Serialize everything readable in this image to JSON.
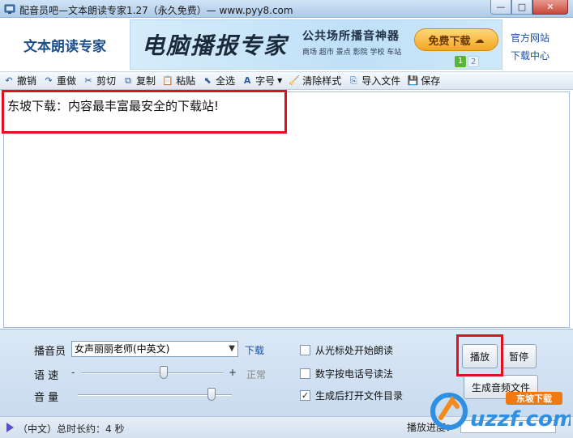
{
  "window": {
    "title": "配音员吧—文本朗读专家1.27（永久免费）— www.pyy8.com",
    "controls": [
      "—",
      "□",
      "✕"
    ]
  },
  "banner": {
    "brand": "文本朗读专家",
    "ad_title": "电脑播报专家",
    "ad_tagline": "公共场所播音神器",
    "ad_places": "商场 超市 景点 影院 学校 车站",
    "ad_button": "免费下载",
    "ad_pages": [
      "1",
      "2"
    ],
    "link_official": "官方网站",
    "link_download": "下载中心"
  },
  "toolbar": {
    "undo": "撤销",
    "redo": "重做",
    "cut": "剪切",
    "copy": "复制",
    "paste": "粘贴",
    "select_all": "全选",
    "font_size": "字号",
    "clear_style": "清除样式",
    "import_file": "导入文件",
    "save": "保存"
  },
  "editor": {
    "text": "东坡下载：内容最丰富最安全的下载站!"
  },
  "panel": {
    "voice_label": "播音员",
    "voice_value": "女声丽丽老师(中英文)",
    "voice_download": "下载",
    "speed_label": "语 速",
    "speed_minus": "-",
    "speed_plus": "+",
    "speed_status": "正常",
    "speed_level": 0.58,
    "volume_label": "音 量",
    "volume_level": 0.87,
    "opt_from_cursor": "从光标处开始朗读",
    "opt_from_cursor_checked": false,
    "opt_phone_digits": "数字按电话号读法",
    "opt_phone_digits_checked": false,
    "opt_open_dir": "生成后打开文件目录",
    "opt_open_dir_checked": true,
    "play": "播放",
    "pause": "暂停",
    "generate_audio": "生成音频文件"
  },
  "status": {
    "info": "（中文）总时长约：4 秒",
    "progress_label": "播放进度：",
    "progress": 0
  },
  "watermark": {
    "text": "东坡下载",
    "domain": "uzzf.com"
  },
  "colors": {
    "highlight": "#e0101c",
    "link": "#1a4fa3",
    "brand": "#1f4f88"
  }
}
